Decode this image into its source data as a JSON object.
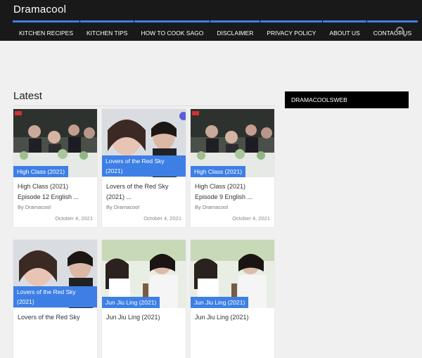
{
  "header": {
    "site_title": "Dramacool",
    "nav": [
      "KITCHEN RECIPES",
      "KITCHEN TIPS",
      "HOW TO COOK SAGO",
      "DISCLAIMER",
      "PRIVACY POLICY",
      "ABOUT US",
      "CONTACT US"
    ],
    "search_icon": "search-icon"
  },
  "colors": {
    "accent": "#3d7fe5",
    "header_bg": "#191919",
    "widget_bg": "#000000"
  },
  "main": {
    "section_title": "Latest",
    "cards": [
      {
        "category": "High Class (2021)",
        "title_line1": "High Class (2021)",
        "title_line2": "Episode 12 English ...",
        "author": "By Dramacool",
        "date": "October 4, 2021"
      },
      {
        "category_line1": "Lovers of the Red Sky",
        "category_line2": "(2021)",
        "title_line1": "Lovers of the Red Sky",
        "title_line2": "(2021) ...",
        "author": "By Dramacool",
        "date": "October 4, 2021"
      },
      {
        "category": "High Class (2021)",
        "title_line1": "High Class (2021)",
        "title_line2": "Episode 9 English ...",
        "author": "By Dramacool",
        "date": "October 4, 2021"
      },
      {
        "category_line1": "Lovers of the Red Sky",
        "category_line2": "(2021)",
        "title_line1": "Lovers of the Red Sky"
      },
      {
        "category": "Jun Jiu Ling (2021)",
        "title_line1": "Jun Jiu Ling (2021)"
      },
      {
        "category": "Jun Jiu Ling (2021)",
        "title_line1": "Jun Jiu Ling (2021)"
      }
    ]
  },
  "sidebar": {
    "widget_title": "DRAMACOOLSWEB"
  }
}
